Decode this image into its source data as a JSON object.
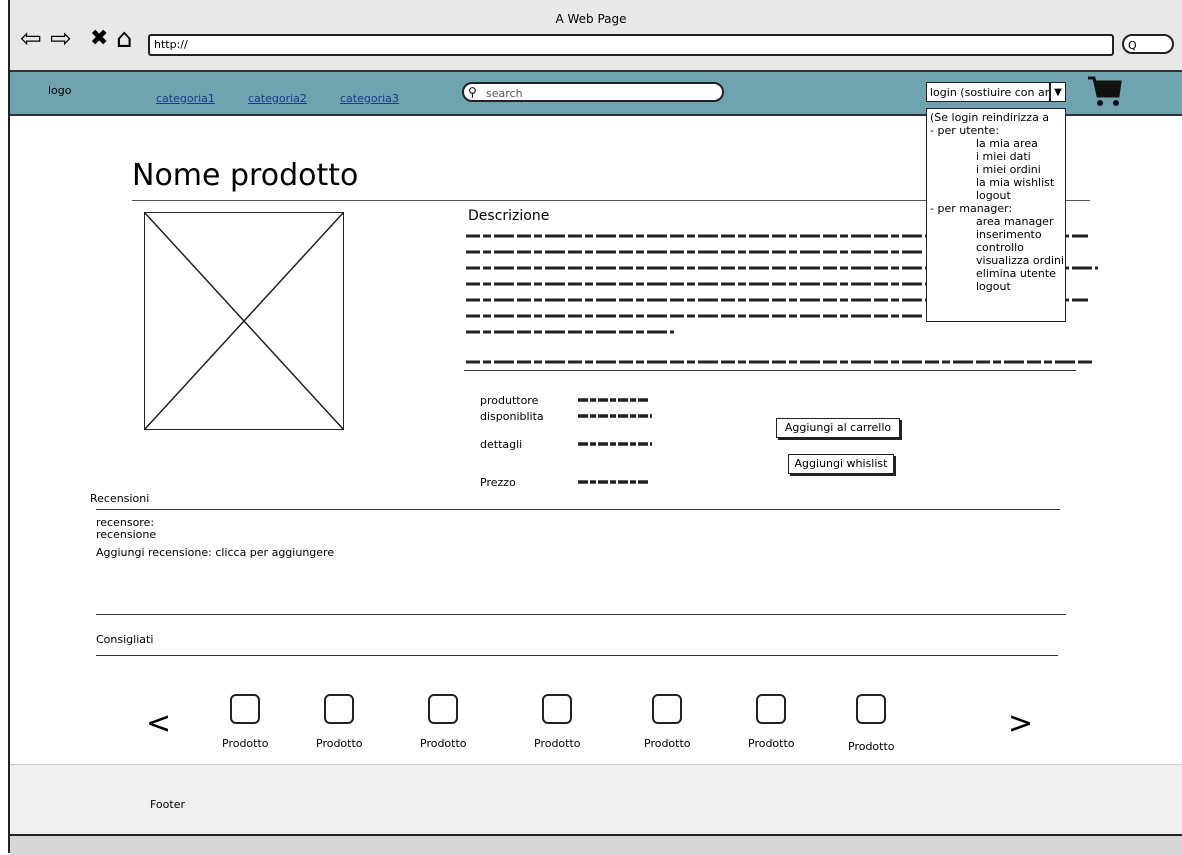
{
  "window": {
    "title": "A Web Page",
    "address": "http://",
    "address_button": "Q"
  },
  "nav": {
    "logo": "logo",
    "categories": [
      "categoria1",
      "categoria2",
      "categoria3"
    ],
    "search_placeholder": "search",
    "login_value": "login (sostiuire con area",
    "cart_icon": "cart-icon"
  },
  "dropdown": {
    "intro": "(Se login reindirizza a",
    "user_header": "- per utente:",
    "user_items": [
      "la mia area",
      "i miei dati",
      "i miei ordini",
      "la mia wishlist",
      "logout"
    ],
    "manager_header": "- per manager:",
    "manager_items": [
      "area manager",
      "inserimento",
      "controllo",
      "visualizza ordini",
      "elimina utente",
      "logout"
    ]
  },
  "product": {
    "title": "Nome prodotto",
    "description_title": "Descrizione",
    "fields": [
      "produttore",
      "disponiblita",
      "dettagli",
      "Prezzo"
    ],
    "add_cart_label": "Aggiungi al carrello",
    "add_wishlist_label": "Aggiungi whislist"
  },
  "reviews": {
    "header": "Recensioni",
    "reviewer": "recensore:",
    "review": "recensione",
    "add_review": "Aggiungi recensione: clicca per aggiungere"
  },
  "recommended": {
    "header": "Consigliati",
    "prev": "<",
    "next": ">",
    "items": [
      "Prodotto",
      "Prodotto",
      "Prodotto",
      "Prodotto",
      "Prodotto",
      "Prodotto",
      "Prodotto"
    ]
  },
  "footer": {
    "text": "Footer"
  }
}
